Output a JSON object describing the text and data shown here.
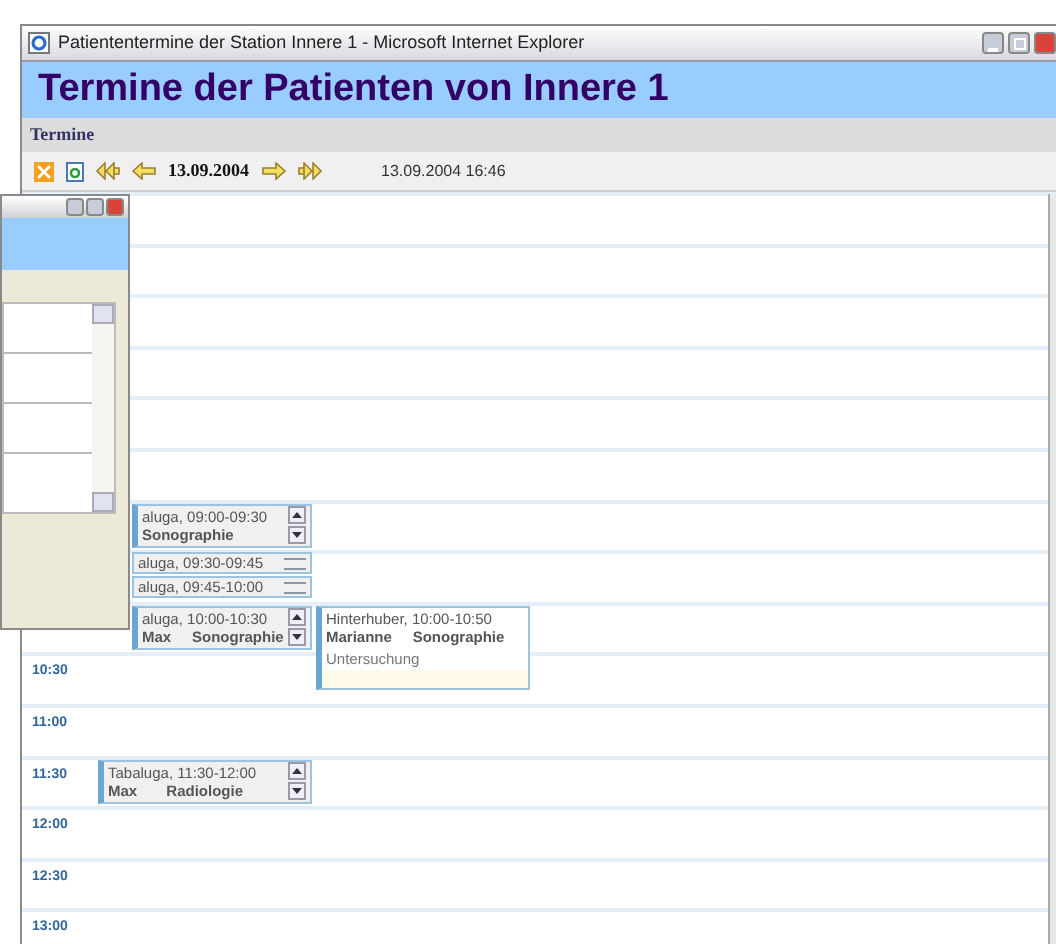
{
  "window": {
    "title": "Patiententermine der Station Innere 1 - Microsoft Internet Explorer"
  },
  "header": {
    "title": "Termine der Patienten von Innere 1"
  },
  "section": {
    "title": "Termine"
  },
  "toolbar": {
    "date": "13.09.2004",
    "timestamp": "13.09.2004 16:46"
  },
  "calendar": {
    "slots": [
      {
        "appointments": [
          {
            "kind": "full",
            "line_1": "aluga, 09:00-09:30",
            "line_2": "Sonographie"
          }
        ]
      },
      {
        "appointments": [
          {
            "kind": "short",
            "line_1": "aluga, 09:30-09:45"
          },
          {
            "kind": "short",
            "line_1": "aluga, 09:45-10:00"
          }
        ]
      },
      {
        "appointments": [
          {
            "kind": "full",
            "line_1": "aluga, 10:00-10:30",
            "line_2": "Max     Sonographie"
          },
          {
            "kind": "note",
            "line_1": "Hinterhuber, 10:00-10:50",
            "line_2": "Marianne     Sonographie",
            "note": "Untersuchung"
          }
        ]
      },
      {
        "time": "10:30"
      },
      {
        "time": "11:00"
      },
      {
        "time": "11:30",
        "appointments": [
          {
            "kind": "full",
            "line_1": "Tabaluga, 11:30-12:00",
            "line_2": "Max       Radiologie"
          }
        ]
      },
      {
        "time": "12:00"
      },
      {
        "time": "12:30"
      },
      {
        "time": "13:00"
      }
    ]
  }
}
